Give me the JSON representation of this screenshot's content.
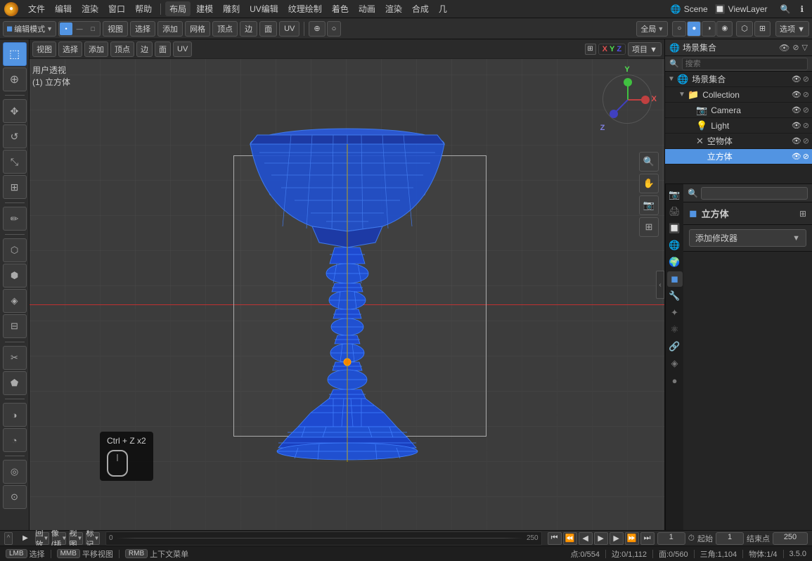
{
  "app_title": "Blender",
  "scene_name": "Scene",
  "view_layer": "ViewLayer",
  "menu": {
    "file": "文件",
    "edit": "编辑",
    "render": "渲染",
    "window": "窗口",
    "help": "帮助",
    "layout": "布局",
    "model": "建模",
    "sculpt": "雕刻",
    "uv": "UV编辑",
    "texture_paint": "纹理绘制",
    "shade": "着色",
    "animation": "动画",
    "render_menu": "渲染",
    "composite": "合成",
    "geometry": "几"
  },
  "toolbar2": {
    "mode": "编辑模式",
    "view": "视图",
    "select": "选择",
    "add": "添加",
    "mesh": "网格",
    "vertex": "顶点",
    "edge": "边",
    "face": "面",
    "uv": "UV",
    "global": "全局",
    "select_btn": "选项 ▼"
  },
  "viewport": {
    "mode_label": "用户透视",
    "object_label": "(1) 立方体",
    "axis_x": "X",
    "axis_y": "Y",
    "axis_z": "Z",
    "coord_display": "项目 ▼"
  },
  "undo_hint": {
    "text": "Ctrl + Z x2"
  },
  "scene_outliner": {
    "title": "场景集合",
    "items": [
      {
        "name": "Collection",
        "icon": "📁",
        "indent": 1,
        "expanded": true,
        "eye": true,
        "camera": false
      },
      {
        "name": "Camera",
        "icon": "📷",
        "indent": 2,
        "expanded": false,
        "eye": true,
        "camera": false
      },
      {
        "name": "Light",
        "icon": "💡",
        "indent": 2,
        "expanded": false,
        "eye": true,
        "camera": false
      },
      {
        "name": "空物体",
        "icon": "✕",
        "indent": 2,
        "expanded": false,
        "eye": true,
        "camera": false
      },
      {
        "name": "立方体",
        "icon": "◼",
        "indent": 2,
        "expanded": false,
        "eye": true,
        "camera": false,
        "active": true
      }
    ]
  },
  "properties": {
    "object_name": "立方体",
    "add_modifier_btn": "添加修改器",
    "search_placeholder": ""
  },
  "timeline": {
    "playback": "回放",
    "keying": "抠像(插帧)",
    "view": "视图",
    "marker": "标记",
    "frame_current": "1",
    "frame_start": "1",
    "frame_end": "250",
    "label_start": "起始",
    "label_end": "结束点"
  },
  "status_bar": {
    "select": "选择",
    "pan": "平移视图",
    "context_menu": "上下文菜单",
    "vertex_count": "点:0/554",
    "edge_count": "边:0/1,112",
    "face_count": "面:0/560",
    "tri_count": "三角:1,104",
    "object_count": "物体:1/4",
    "version": "3.5.0"
  },
  "right_icons": [
    {
      "name": "render-icon",
      "symbol": "📷",
      "active": false
    },
    {
      "name": "output-icon",
      "symbol": "🖼",
      "active": false
    },
    {
      "name": "view-layer-icon",
      "symbol": "🔲",
      "active": false
    },
    {
      "name": "scene-icon",
      "symbol": "🌐",
      "active": false
    },
    {
      "name": "world-icon",
      "symbol": "🌍",
      "active": false
    },
    {
      "name": "object-icon",
      "symbol": "◼",
      "active": true
    },
    {
      "name": "modifier-icon",
      "symbol": "🔧",
      "active": false
    },
    {
      "name": "particles-icon",
      "symbol": "✦",
      "active": false
    },
    {
      "name": "physics-icon",
      "symbol": "⚛",
      "active": false
    },
    {
      "name": "constraints-icon",
      "symbol": "🔗",
      "active": false
    },
    {
      "name": "data-icon",
      "symbol": "◈",
      "active": false
    },
    {
      "name": "material-icon",
      "symbol": "●",
      "active": false
    }
  ]
}
